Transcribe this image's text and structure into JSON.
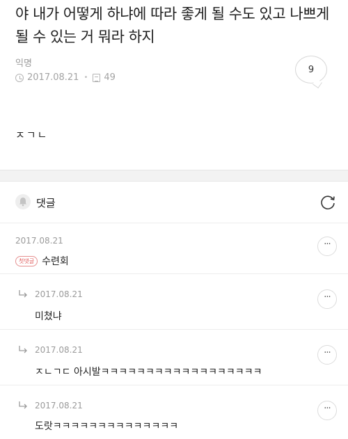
{
  "post": {
    "title": "야 내가 어떻게 하냐에 따라 좋게 될 수도 있고 나쁘게 될 수 있는 거 뭐라 하지",
    "author": "익명",
    "date": "2017.08.21",
    "views": "49",
    "comment_count": "9",
    "body": "ㅈㄱㄴ"
  },
  "comments_header": {
    "label": "댓글"
  },
  "comments": [
    {
      "date": "2017.08.21",
      "badge": "첫댓글",
      "text": "수련회",
      "more": "···"
    },
    {
      "date": "2017.08.21",
      "text": "미쳤냐",
      "more": "···"
    },
    {
      "date": "2017.08.21",
      "text": "ㅈㄴㄱㄷ 아시발ㅋㅋㅋㅋㅋㅋㅋㅋㅋㅋㅋㅋㅋㅋㅋㅋㅋㅋ",
      "more": "···"
    },
    {
      "date": "2017.08.21",
      "text": "도랏ㅋㅋㅋㅋㅋㅋㅋㅋㅋㅋㅋㅋㅋㅋ",
      "more": "···"
    }
  ]
}
